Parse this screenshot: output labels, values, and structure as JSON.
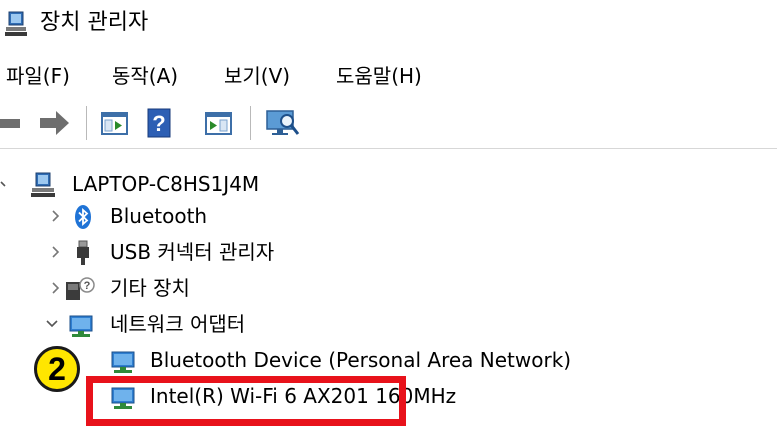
{
  "window": {
    "title": "장치 관리자"
  },
  "menu": {
    "items": [
      "파일(F)",
      "동작(A)",
      "보기(V)",
      "도움말(H)"
    ]
  },
  "toolbar": {
    "buttons": [
      "back-icon",
      "forward-icon",
      "properties-icon",
      "help-icon",
      "update-driver-icon",
      "scan-hardware-icon"
    ]
  },
  "tree": {
    "root": {
      "label": "LAPTOP-C8HS1J4M",
      "expanded": true
    },
    "categories": [
      {
        "label": "Bluetooth",
        "expanded": false,
        "icon": "bluetooth-icon"
      },
      {
        "label": "USB 커넥터 관리자",
        "expanded": false,
        "icon": "usb-icon"
      },
      {
        "label": "기타 장치",
        "expanded": false,
        "icon": "unknown-device-icon"
      },
      {
        "label": "네트워크 어댑터",
        "expanded": true,
        "icon": "network-adapter-icon"
      }
    ],
    "network_devices": [
      {
        "label": "Bluetooth Device (Personal Area Network)"
      },
      {
        "label": "Intel(R) Wi-Fi 6 AX201 160MHz",
        "highlighted": true
      }
    ]
  },
  "annotation": {
    "step_number": "2",
    "color": "#e8121b",
    "badge_color": "#ffe600"
  }
}
